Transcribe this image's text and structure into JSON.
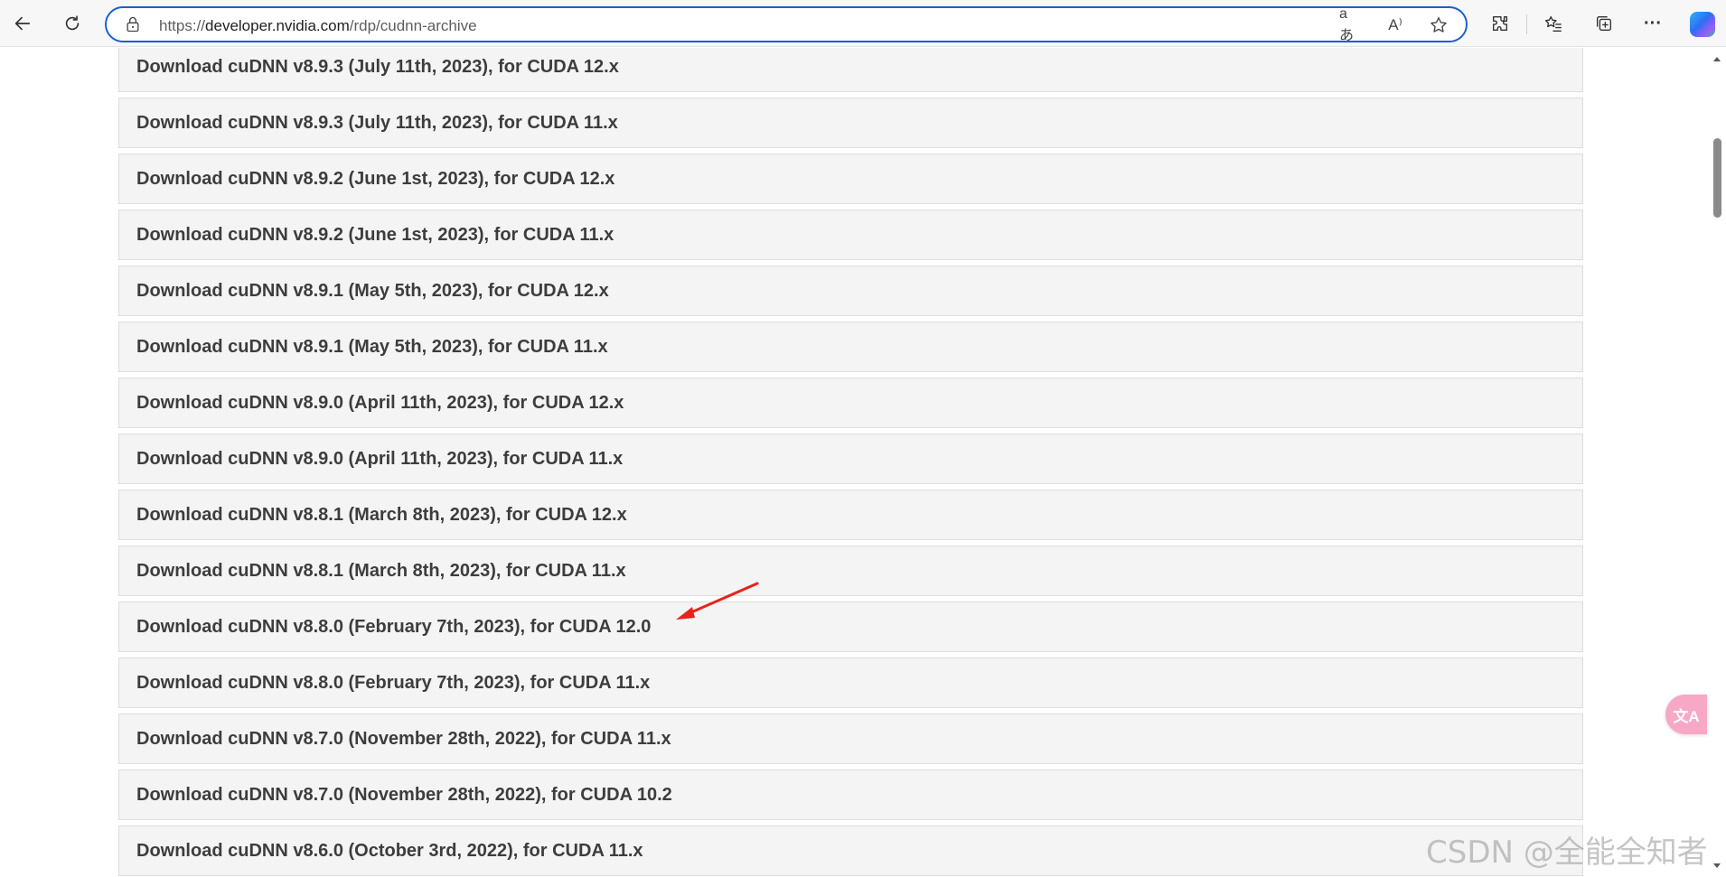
{
  "browser": {
    "url_prefix": "https://",
    "url_host": "developer.nvidia.com",
    "url_path": "/rdp/cudnn-archive",
    "translate_glyph": "aあ",
    "read_aloud_glyph": "A⁾",
    "more_glyph": "···"
  },
  "downloads": [
    {
      "label": "Download cuDNN v8.9.3 (July 11th, 2023), for CUDA 12.x"
    },
    {
      "label": "Download cuDNN v8.9.3 (July 11th, 2023), for CUDA 11.x"
    },
    {
      "label": "Download cuDNN v8.9.2 (June 1st, 2023), for CUDA 12.x"
    },
    {
      "label": "Download cuDNN v8.9.2 (June 1st, 2023), for CUDA 11.x"
    },
    {
      "label": "Download cuDNN v8.9.1 (May 5th, 2023), for CUDA 12.x"
    },
    {
      "label": "Download cuDNN v8.9.1 (May 5th, 2023), for CUDA 11.x"
    },
    {
      "label": "Download cuDNN v8.9.0 (April 11th, 2023), for CUDA 12.x"
    },
    {
      "label": "Download cuDNN v8.9.0 (April 11th, 2023), for CUDA 11.x"
    },
    {
      "label": "Download cuDNN v8.8.1 (March 8th, 2023), for CUDA 12.x"
    },
    {
      "label": "Download cuDNN v8.8.1 (March 8th, 2023), for CUDA 11.x"
    },
    {
      "label": "Download cuDNN v8.8.0 (February 7th, 2023), for CUDA 12.0"
    },
    {
      "label": "Download cuDNN v8.8.0 (February 7th, 2023), for CUDA 11.x"
    },
    {
      "label": "Download cuDNN v8.7.0 (November 28th, 2022), for CUDA 11.x"
    },
    {
      "label": "Download cuDNN v8.7.0 (November 28th, 2022), for CUDA 10.2"
    },
    {
      "label": "Download cuDNN v8.6.0 (October 3rd, 2022), for CUDA 11.x"
    }
  ],
  "translate_float": {
    "label": "文A"
  },
  "annotation": {
    "color": "#e8231c",
    "points_to": "Download cuDNN v8.8.0 (February 7th, 2023), for CUDA 12.0"
  },
  "watermark": "CSDN @全能全知者",
  "colors": {
    "accent": "#1a5fd1",
    "row_bg": "#f4f4f4",
    "row_text": "#3d3d3d"
  },
  "icons": [
    "back-icon",
    "refresh-icon",
    "lock-icon",
    "translate-icon",
    "read-aloud-icon",
    "favorite-star-icon",
    "extensions-icon",
    "favorites-icon",
    "collections-icon",
    "more-icon",
    "copilot-icon"
  ]
}
